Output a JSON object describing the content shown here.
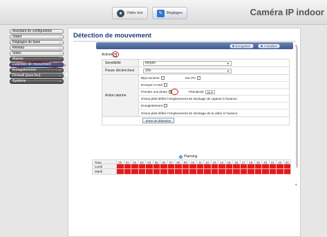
{
  "topbar": {
    "tabs": [
      {
        "label": "Vidéo live",
        "icon": "eye-icon"
      },
      {
        "label": "Réglages",
        "icon": "wrench-icon"
      }
    ],
    "brand": "Caméra IP indoor"
  },
  "sidebar": {
    "items": [
      {
        "label": "Assistant de configuration",
        "chevron": ""
      },
      {
        "label": "Statut",
        "chevron": "⌄"
      },
      {
        "label": "Réglages de base",
        "chevron": "⌄"
      },
      {
        "label": "Réseau",
        "chevron": "⌄"
      },
      {
        "label": "Vidéo",
        "chevron": "⌄"
      },
      {
        "label": "Alarme",
        "chevron": "⌃"
      },
      {
        "label": "Détection de mouvement",
        "chevron": ""
      },
      {
        "label": "Enregistrement",
        "chevron": "⌄"
      },
      {
        "label": "Firewall (pare-feu)",
        "chevron": "⌄"
      },
      {
        "label": "Système",
        "chevron": "⌄"
      }
    ]
  },
  "main": {
    "title": "Détection de mouvement",
    "buttons": {
      "save": "Enregistrer",
      "refresh": "Actualiser"
    },
    "activer_label": "Activer",
    "form": {
      "sensibilite": {
        "label": "Sensibilité",
        "value": "moyen"
      },
      "pause": {
        "label": "Pause déclencheur",
        "value": "10s"
      },
      "action_label": "Action alarme",
      "bips": "Bips sonores",
      "son_pc": "Son PC",
      "email": "Envoyer e-mail",
      "photo": "Prendre une photo",
      "periodicite_label": "Périodicité",
      "periodicite_value": "2s",
      "photo_note": "SVous plaît définir l'emplacement de stockage de capture à l'avance.",
      "enregistrement": "Enregistrement",
      "video_note": "SVous plaît définir l'emplacement de stockage de la vidéo à l'avance.",
      "zone_button": "Zone de détection"
    },
    "planning": {
      "label": "Planning",
      "header_label": "Tous",
      "hours": [
        "00",
        "01",
        "02",
        "03",
        "04",
        "05",
        "06",
        "07",
        "08",
        "09",
        "10",
        "11",
        "12",
        "13",
        "14",
        "15",
        "16",
        "17",
        "18",
        "19",
        "20",
        "21",
        "22",
        "23"
      ],
      "days": [
        "Lundi",
        "Mardi"
      ]
    }
  },
  "colors": {
    "accent": "#1f3d7a",
    "alert": "#e31b1b",
    "highlight": "#cc1d1d"
  }
}
